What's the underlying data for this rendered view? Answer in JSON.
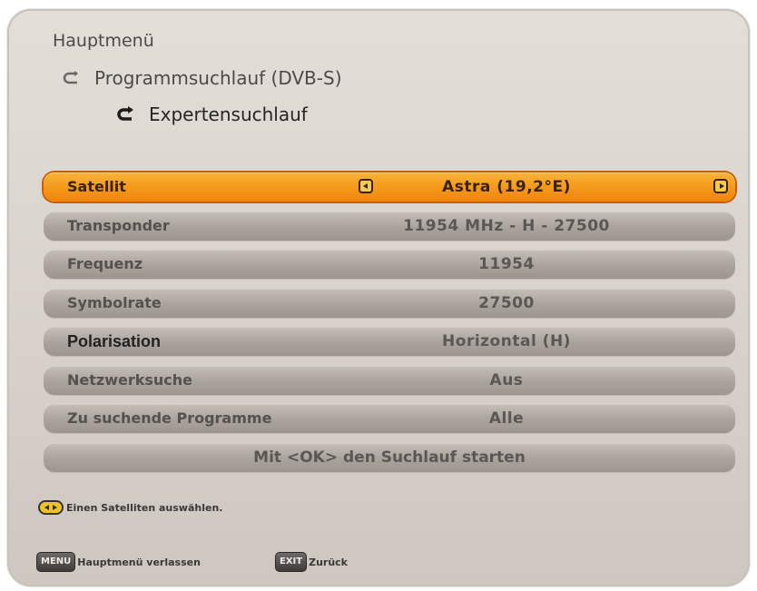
{
  "breadcrumb": {
    "root": "Hauptmenü",
    "level1": "Programmsuchlauf (DVB-S)",
    "level2": "Expertensuchlauf"
  },
  "settings": [
    {
      "label": "Satellit",
      "value": "Astra (19,2°E)"
    },
    {
      "label": "Transponder",
      "value": "11954 MHz - H - 27500"
    },
    {
      "label": "Frequenz",
      "value": "11954"
    },
    {
      "label": "Symbolrate",
      "value": "27500"
    },
    {
      "label": "Polarisation",
      "value": "Horizontal (H)"
    },
    {
      "label": "Netzwerksuche",
      "value": "Aus"
    },
    {
      "label": "Zu suchende Programme",
      "value": "Alle"
    }
  ],
  "action": {
    "label": "Mit <OK> den Suchlauf starten"
  },
  "hint": {
    "text": "Einen Satelliten auswählen."
  },
  "footer": {
    "menu_key": "MENU",
    "menu_text": "Hauptmenü verlassen",
    "exit_key": "EXIT",
    "exit_text": "Zurück"
  },
  "icons": {
    "back": "return-arrow-icon",
    "nav_left": "arrow-left-icon",
    "nav_right": "arrow-right-icon",
    "hint": "left-right-key-icon"
  },
  "colors": {
    "highlight": "#f49a1c",
    "row": "#aaa39d",
    "panel": "#d8d2cb"
  }
}
